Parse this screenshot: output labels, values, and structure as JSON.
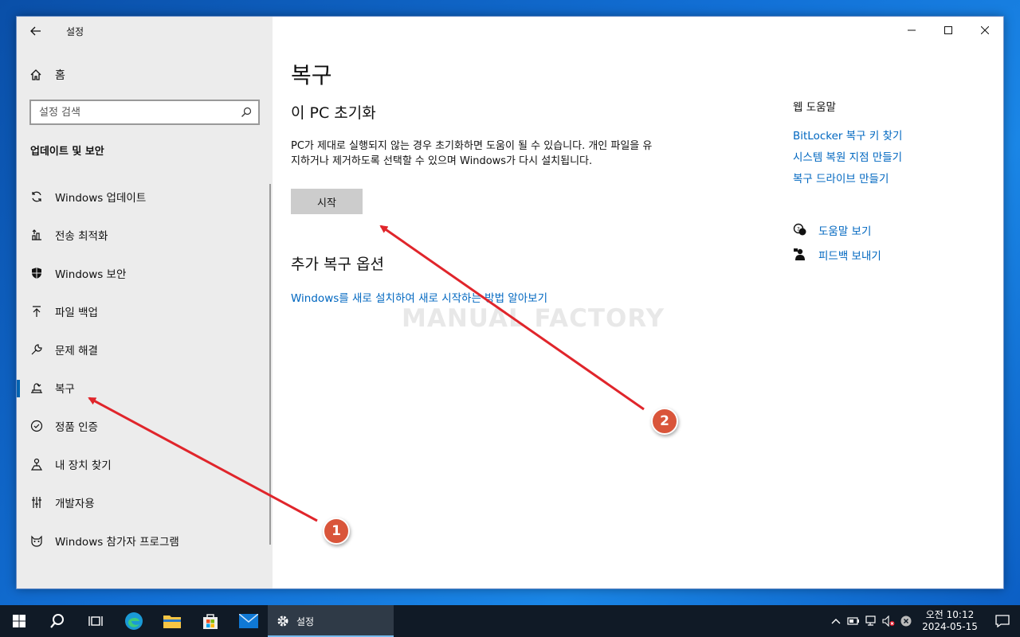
{
  "window": {
    "title": "설정",
    "back_label": "←",
    "minimize": "—",
    "close": "✕"
  },
  "sidebar": {
    "home_label": "홈",
    "search_placeholder": "설정 검색",
    "section_title": "업데이트 및 보안",
    "items": [
      {
        "label": "Windows 업데이트",
        "icon": "sync-icon"
      },
      {
        "label": "전송 최적화",
        "icon": "delivery-optimization-icon"
      },
      {
        "label": "Windows 보안",
        "icon": "shield-icon"
      },
      {
        "label": "파일 백업",
        "icon": "backup-arrow-icon"
      },
      {
        "label": "문제 해결",
        "icon": "wrench-icon"
      },
      {
        "label": "복구",
        "icon": "recovery-icon",
        "active": true
      },
      {
        "label": "정품 인증",
        "icon": "check-circle-icon"
      },
      {
        "label": "내 장치 찾기",
        "icon": "find-device-icon"
      },
      {
        "label": "개발자용",
        "icon": "developer-icon"
      },
      {
        "label": "Windows 참가자 프로그램",
        "icon": "insider-cat-icon"
      }
    ]
  },
  "main": {
    "page_title": "복구",
    "reset_title": "이 PC 초기화",
    "reset_desc": "PC가 제대로 실행되지 않는 경우 초기화하면 도움이 될 수 있습니다. 개인 파일을 유지하거나 제거하도록 선택할 수 있으며 Windows가 다시 설치됩니다.",
    "start_button": "시작",
    "more_title": "추가 복구 옵션",
    "more_link": "Windows를 새로 설치하여 새로 시작하는 방법 알아보기"
  },
  "right": {
    "web_help_title": "웹 도움말",
    "links": [
      "BitLocker 복구 키 찾기",
      "시스템 복원 지점 만들기",
      "복구 드라이브 만들기"
    ],
    "get_help": "도움말 보기",
    "feedback": "피드백 보내기"
  },
  "watermark": "MANUAL FACTORY",
  "annotations": {
    "badge1": "1",
    "badge2": "2",
    "color": "#e0252b"
  },
  "taskbar": {
    "active_app": "설정",
    "time": "오전 10:12",
    "date": "2024-05-15"
  }
}
